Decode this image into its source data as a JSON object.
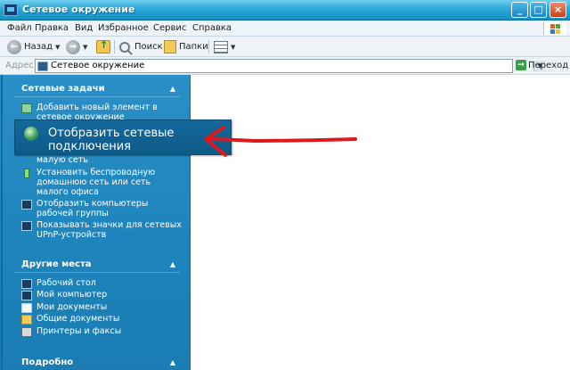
{
  "window": {
    "title": "Сетевое окружение",
    "controls": {
      "minimize": "_",
      "maximize": "□",
      "close": "×"
    }
  },
  "menu": [
    "Файл",
    "Правка",
    "Вид",
    "Избранное",
    "Сервис",
    "Справка"
  ],
  "toolbar": {
    "back_label": "Назад",
    "search_label": "Поиск",
    "folders_label": "Папки"
  },
  "address": {
    "label": "Адрес",
    "value": "Сетевое окружение",
    "go_label": "Переход"
  },
  "sidebar": {
    "network_tasks": {
      "title": "Сетевые задачи",
      "items": [
        {
          "label": "Добавить новый элемент в сетевое окружение",
          "icon": "add-network-place-icon"
        },
        {
          "label": "малую сеть",
          "icon": "network-icon"
        },
        {
          "label": "Установить беспроводную домашнюю сеть или сеть малого офиса",
          "icon": "wireless-icon"
        },
        {
          "label": "Отобразить компьютеры рабочей группы",
          "icon": "workgroup-icon"
        },
        {
          "label": "Показывать значки для сетевых UPnP-устройств",
          "icon": "upnp-icon"
        }
      ]
    },
    "other_places": {
      "title": "Другие места",
      "items": [
        {
          "label": "Рабочий стол",
          "icon": "desktop-icon"
        },
        {
          "label": "Мой компьютер",
          "icon": "my-computer-icon"
        },
        {
          "label": "Мои документы",
          "icon": "my-documents-icon"
        },
        {
          "label": "Общие документы",
          "icon": "shared-documents-icon"
        },
        {
          "label": "Принтеры и факсы",
          "icon": "printers-icon"
        }
      ]
    },
    "details": {
      "title": "Подробно"
    }
  },
  "tooltip": {
    "text": "Отобразить сетевые подключения",
    "icon": "network-connections-icon"
  },
  "annotation": {
    "color": "#e0181c"
  },
  "colors": {
    "title_bar": "#1590c4",
    "sidebar": "#1f86bd",
    "tooltip": "#13689c"
  }
}
